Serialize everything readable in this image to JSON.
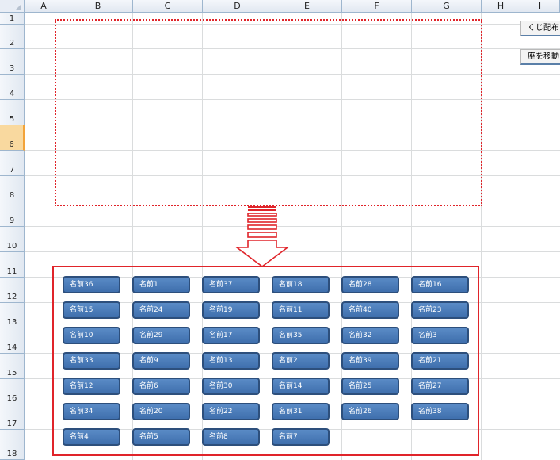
{
  "columns": [
    "A",
    "B",
    "C",
    "D",
    "E",
    "F",
    "G",
    "H",
    "I"
  ],
  "rows": [
    "1",
    "2",
    "3",
    "4",
    "5",
    "6",
    "7",
    "8",
    "9",
    "10",
    "11",
    "12",
    "13",
    "14",
    "15",
    "16",
    "17",
    "18"
  ],
  "active_row": "6",
  "colors": {
    "highlight": "#e0242a",
    "button_fill": "#4a7cb9",
    "button_border": "#2d4f7c",
    "header_bg": "#e1e8f1"
  },
  "icons": {
    "corner": "select-all-triangle",
    "arrow": "down-arrow-striped"
  },
  "side_buttons": [
    "くじ配布",
    "座を移動"
  ],
  "name_buttons": [
    [
      "名前36",
      "名前1",
      "名前37",
      "名前18",
      "名前28",
      "名前16"
    ],
    [
      "名前15",
      "名前24",
      "名前19",
      "名前11",
      "名前40",
      "名前23"
    ],
    [
      "名前10",
      "名前29",
      "名前17",
      "名前35",
      "名前32",
      "名前3"
    ],
    [
      "名前33",
      "名前9",
      "名前13",
      "名前2",
      "名前39",
      "名前21"
    ],
    [
      "名前12",
      "名前6",
      "名前30",
      "名前14",
      "名前25",
      "名前27"
    ],
    [
      "名前34",
      "名前20",
      "名前22",
      "名前31",
      "名前26",
      "名前38"
    ],
    [
      "名前4",
      "名前5",
      "名前8",
      "名前7"
    ]
  ]
}
